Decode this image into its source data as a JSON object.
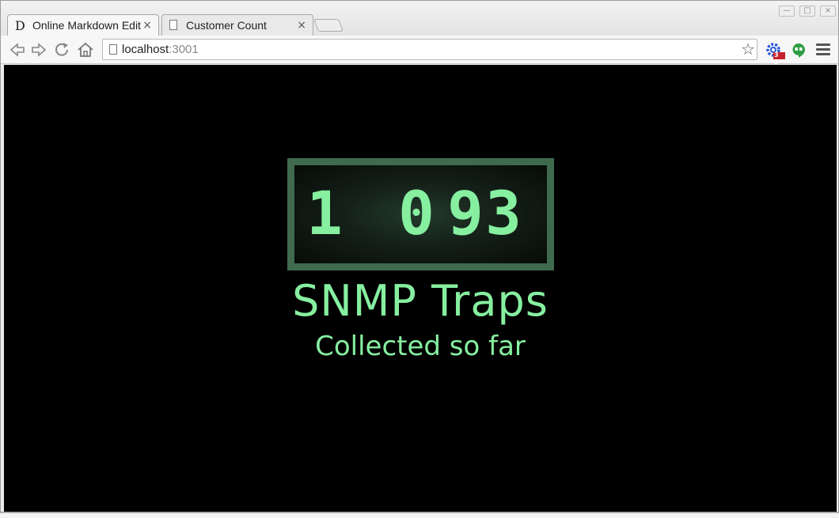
{
  "browser": {
    "tabs": [
      {
        "favicon": "D",
        "title": "Online Markdown Edit",
        "close": "×"
      },
      {
        "favicon": "page-icon",
        "title": "Customer Count",
        "close": "×"
      }
    ],
    "address": {
      "host": "localhost",
      "port": ":3001"
    },
    "extension_badge": "3 3"
  },
  "page": {
    "counter_digits": [
      "1",
      "0",
      "9",
      "3"
    ],
    "title": "SNMP Traps",
    "subtitle": "Collected so far"
  },
  "colors": {
    "accent": "#86efa0",
    "counter_frame": "#3f6a4e",
    "page_background": "#000000"
  }
}
